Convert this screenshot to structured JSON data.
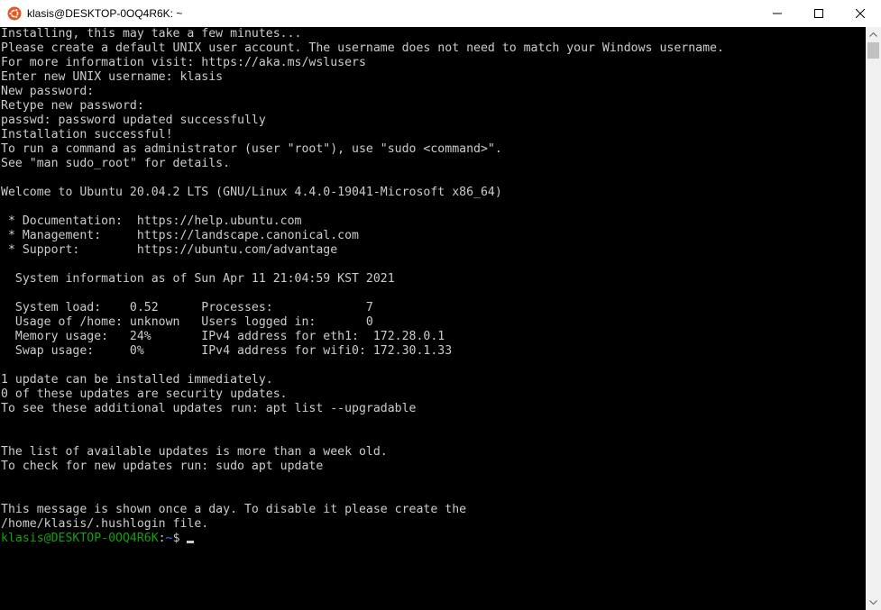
{
  "window": {
    "title": "klasis@DESKTOP-0OQ4R6K: ~",
    "icons": {
      "app": "ubuntu-logo-icon",
      "minimize": "minimize-icon",
      "maximize": "maximize-icon",
      "close": "close-icon"
    }
  },
  "terminal": {
    "lines": [
      "Installing, this may take a few minutes...",
      "Please create a default UNIX user account. The username does not need to match your Windows username.",
      "For more information visit: https://aka.ms/wslusers",
      "Enter new UNIX username: klasis",
      "New password:",
      "Retype new password:",
      "passwd: password updated successfully",
      "Installation successful!",
      "To run a command as administrator (user \"root\"), use \"sudo <command>\".",
      "See \"man sudo_root\" for details.",
      "",
      "Welcome to Ubuntu 20.04.2 LTS (GNU/Linux 4.4.0-19041-Microsoft x86_64)",
      "",
      " * Documentation:  https://help.ubuntu.com",
      " * Management:     https://landscape.canonical.com",
      " * Support:        https://ubuntu.com/advantage",
      "",
      "  System information as of Sun Apr 11 21:04:59 KST 2021",
      "",
      "  System load:    0.52      Processes:             7",
      "  Usage of /home: unknown   Users logged in:       0",
      "  Memory usage:   24%       IPv4 address for eth1:  172.28.0.1",
      "  Swap usage:     0%        IPv4 address for wifi0: 172.30.1.33",
      "",
      "1 update can be installed immediately.",
      "0 of these updates are security updates.",
      "To see these additional updates run: apt list --upgradable",
      "",
      "",
      "The list of available updates is more than a week old.",
      "To check for new updates run: sudo apt update",
      "",
      "",
      "This message is shown once a day. To disable it please create the",
      "/home/klasis/.hushlogin file."
    ],
    "prompt": {
      "user_host": "klasis@DESKTOP-0OQ4R6K",
      "separator": ":",
      "path": "~",
      "symbol": "$ "
    },
    "colors": {
      "background": "#000000",
      "text": "#cccccc",
      "prompt_user": "#13a10e",
      "prompt_path": "#3b78ff"
    }
  }
}
